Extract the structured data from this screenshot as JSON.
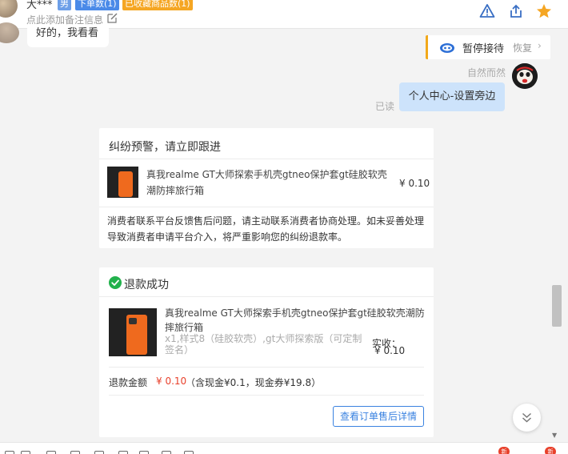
{
  "customer": {
    "name": "大***",
    "gender_tag": "男",
    "orders_tag": "下单数(1)",
    "fav_tag": "已收藏商品数(1)",
    "note_placeholder": "点此添加备注信息"
  },
  "icons": {
    "edit": "edit-icon",
    "warning": "warning-icon",
    "share": "share-icon",
    "star": "star-icon",
    "robot": "robot-icon",
    "check": "check-circle-icon",
    "chevron_down": "chevron-down-double-icon"
  },
  "colors": {
    "gender_tag": "#6d9fe8",
    "orders_tag": "#4a8ae8",
    "fav_tag": "#f5a623",
    "pause_accent": "#f2a91a",
    "self_bubble": "#cde3fb",
    "price_red": "#e8412c",
    "link_blue": "#3a82e0",
    "success_green": "#22b14c"
  },
  "messages": {
    "incoming_text": "好的，我看看",
    "sender_name": "自然而然",
    "read_status": "已读",
    "outgoing_text": "个人中心-设置旁边"
  },
  "pause": {
    "label": "暂停接待",
    "resume": "恢复"
  },
  "dispute_card": {
    "title": "纠纷预警，请立即跟进",
    "product_title": "真我realme GT大师探索手机壳gtneo保护套gt硅胶软壳潮防摔旅行箱",
    "price": "¥ 0.10",
    "description": "消费者联系平台反馈售后问题，请主动联系消费者协商处理。如未妥善处理导致消费者申请平台介入，将严重影响您的纠纷退款率。"
  },
  "refund_card": {
    "title": "退款成功",
    "product_title": "真我realme GT大师探索手机壳gtneo保护套gt硅胶软壳潮防摔旅行箱",
    "spec": "x1,样式8（硅胶软壳）,gt大师探索版（可定制签名）",
    "actual_label": "实收：",
    "actual_value": "¥ 0.10",
    "amount_label": "退款金额",
    "amount": "¥ 0.10",
    "amount_detail": "（含现金¥0.1，现金券¥19.8）",
    "detail_button": "查看订单售后详情"
  },
  "toolbar": {
    "new_badge": "新"
  }
}
